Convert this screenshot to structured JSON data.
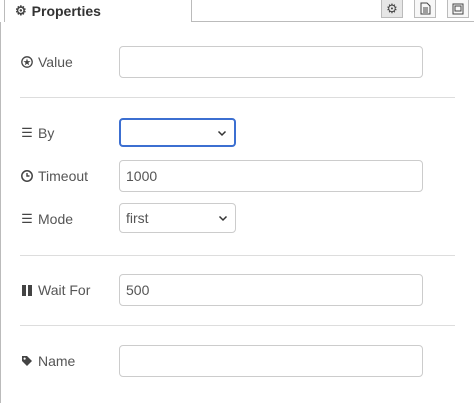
{
  "tab": {
    "title": "Properties",
    "icon": "gear-icon"
  },
  "toolbar": {
    "settings_icon": "gear-icon",
    "description_icon": "document-icon",
    "appearance_icon": "appearance-icon"
  },
  "fields": {
    "value": {
      "label": "Value",
      "icon": "circle-star-icon",
      "value": ""
    },
    "by": {
      "label": "By",
      "icon": "list-icon",
      "selected": ""
    },
    "timeout": {
      "label": "Timeout",
      "icon": "clock-icon",
      "value": "1000"
    },
    "mode": {
      "label": "Mode",
      "icon": "list-icon",
      "selected": "first"
    },
    "wait_for": {
      "label": "Wait For",
      "icon": "pause-icon",
      "value": "500"
    },
    "name": {
      "label": "Name",
      "icon": "tag-icon",
      "value": ""
    }
  },
  "colors": {
    "focus_border": "#3c6fd1",
    "input_border": "#cccccc",
    "divider": "#dddddd"
  }
}
